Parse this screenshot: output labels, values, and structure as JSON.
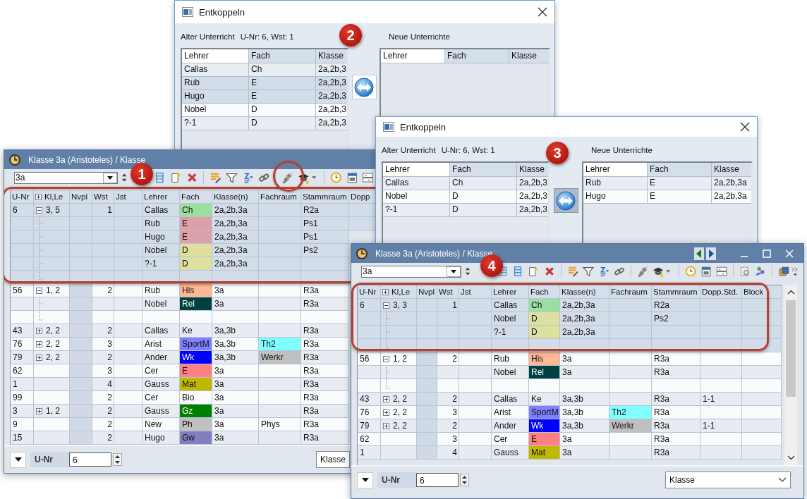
{
  "dialogs": [
    {
      "title": "Entkoppeln",
      "old_label": "Alter Unterricht",
      "old_info": "U-Nr: 6, Wst: 1",
      "new_label": "Neue Unterrichte",
      "badge": "2",
      "swap_pressed": false,
      "old_table": {
        "columns": [
          "Lehrer",
          "Fach",
          "Klasse"
        ],
        "rows": [
          {
            "cells": [
              "Callas",
              "Ch",
              "2a,2b,3"
            ],
            "selected": false
          },
          {
            "cells": [
              "Rub",
              "E",
              "2a,2b,3"
            ],
            "selected": true
          },
          {
            "cells": [
              "Hugo",
              "E",
              "2a,2b,3"
            ],
            "selected": true
          },
          {
            "cells": [
              "Nobel",
              "D",
              "2a,2b,3"
            ],
            "selected": false
          },
          {
            "cells": [
              "?-1",
              "D",
              "2a,2b,3"
            ],
            "selected": false
          }
        ]
      },
      "new_table": {
        "columns": [
          "Lehrer",
          "Fach",
          "Klasse"
        ]
      }
    },
    {
      "title": "Entkoppeln",
      "old_label": "Alter Unterricht",
      "old_info": "U-Nr: 6, Wst: 1",
      "new_label": "Neue Unterrichte",
      "badge": "3",
      "swap_pressed": true,
      "old_table": {
        "columns": [
          "Lehrer",
          "Fach",
          "Klasse"
        ],
        "rows": [
          {
            "cells": [
              "Callas",
              "Ch",
              "2a,2b,3"
            ],
            "selected": false
          },
          {
            "cells": [
              "Nobel",
              "D",
              "2a,2b,3"
            ],
            "selected": false
          },
          {
            "cells": [
              "?-1",
              "D",
              "2a,2b,3"
            ],
            "selected": false
          }
        ]
      },
      "new_table": {
        "columns": [
          "Lehrer",
          "Fach",
          "Klasse"
        ],
        "rows": [
          {
            "cells": [
              "Rub",
              "E",
              "2a,2b,3a"
            ],
            "selected": false
          },
          {
            "cells": [
              "Hugo",
              "E",
              "2a,2b,3a"
            ],
            "selected": false
          }
        ]
      }
    }
  ],
  "windows": [
    {
      "title": "Klasse 3a (Aristoteles) / Klasse",
      "class_value": "3a",
      "badge": "1",
      "columns": [
        "U-Nr",
        "Kl,Le",
        "Nvpl",
        "Wst",
        "Jst",
        "Lehrer",
        "Fach",
        "Klasse(n)",
        "Fachraum",
        "Stammraum",
        "Dopp"
      ],
      "rows": [
        {
          "u_nr": "6",
          "kl_le": "3, 5",
          "expanded": true,
          "wst": "1",
          "lehrer": "Callas",
          "fach": {
            "text": "Ch",
            "color": "#99e0a0"
          },
          "klassen": "2a,2b,3a",
          "stammraum": "R2a",
          "selected": true,
          "children": [
            {
              "lehrer": "Rub",
              "fach": {
                "text": "E",
                "color": "#dca0a8"
              },
              "klassen": "2a,2b,3a",
              "stammraum": "Ps1"
            },
            {
              "lehrer": "Hugo",
              "fach": {
                "text": "E",
                "color": "#dca0a8"
              },
              "klassen": "2a,2b,3a",
              "stammraum": "Ps1"
            },
            {
              "lehrer": "Nobel",
              "fach": {
                "text": "D",
                "color": "#dee0a0"
              },
              "klassen": "2a,2b,3a",
              "stammraum": "Ps2"
            },
            {
              "lehrer": "?-1",
              "fach": {
                "text": "D",
                "color": "#dee0a0"
              },
              "klassen": "2a,2b,3a"
            }
          ]
        },
        {
          "u_nr": "56",
          "kl_le": "1, 2",
          "expanded": true,
          "wst": "2",
          "lehrer": "Rub",
          "fach": {
            "text": "His",
            "color": "#ffb894"
          },
          "klassen": "3a",
          "stammraum": "R3a",
          "selected": false,
          "children": [
            {
              "lehrer": "Nobel",
              "fach": {
                "text": "Rel",
                "color": "#004040"
              },
              "klassen": "3a",
              "stammraum": "R3a"
            }
          ]
        },
        {
          "u_nr": "43",
          "kl_le": "2, 2",
          "expanded": false,
          "wst": "2",
          "lehrer": "Callas",
          "fach": {
            "text": "Ke"
          },
          "klassen": "3a,3b",
          "stammraum": "R3a",
          "selected": false
        },
        {
          "u_nr": "76",
          "kl_le": "2, 2",
          "expanded": false,
          "wst": "3",
          "lehrer": "Arist",
          "fach": {
            "text": "SportM",
            "color": "#8080ff"
          },
          "klassen": "3a,3b",
          "fachraum": {
            "text": "Th2",
            "color": "#80ffff"
          },
          "stammraum": "R3a",
          "selected": false
        },
        {
          "u_nr": "79",
          "kl_le": "2, 2",
          "expanded": false,
          "wst": "2",
          "lehrer": "Ander",
          "fach": {
            "text": "Wk",
            "color": "#0000ff"
          },
          "klassen": "3a,3b",
          "fachraum": {
            "text": "Werkr",
            "color": "#c0c0c0"
          },
          "stammraum": "R3a",
          "selected": false
        },
        {
          "u_nr": "62",
          "wst": "3",
          "lehrer": "Cer",
          "fach": {
            "text": "E",
            "color": "#ff8080"
          },
          "klassen": "3a",
          "stammraum": "R3a",
          "selected": false
        },
        {
          "u_nr": "1",
          "wst": "4",
          "lehrer": "Gauss",
          "fach": {
            "text": "Mat",
            "color": "#c0b800"
          },
          "klassen": "3a",
          "stammraum": "R3a",
          "selected": false
        },
        {
          "u_nr": "99",
          "wst": "2",
          "lehrer": "Cer",
          "fach": {
            "text": "Bio"
          },
          "klassen": "3a",
          "stammraum": "R3a",
          "selected": false
        },
        {
          "u_nr": "3",
          "kl_le": "1, 2",
          "expanded": false,
          "wst": "2",
          "lehrer": "Gauss",
          "fach": {
            "text": "Gz",
            "color": "#008000"
          },
          "klassen": "3a",
          "stammraum": "R3a",
          "selected": false
        },
        {
          "u_nr": "9",
          "wst": "2",
          "lehrer": "New",
          "fach": {
            "text": "Ph",
            "color": "#c0c0c0"
          },
          "klassen": "3a",
          "fachraum": {
            "text": "Phys"
          },
          "stammraum": "R3a",
          "selected": false
        },
        {
          "u_nr": "15",
          "wst": "2",
          "lehrer": "Hugo",
          "fach": {
            "text": "Gw",
            "color": "#8080c0"
          },
          "klassen": "3a",
          "stammraum": "R3a",
          "selected": false
        }
      ],
      "footer": {
        "label": "U-Nr",
        "value": "6",
        "view": "Klasse"
      }
    },
    {
      "title": "Klasse 3a (Aristoteles) / Klasse",
      "class_value": "3a",
      "badge": "4",
      "columns": [
        "U-Nr",
        "Kl,Le",
        "Nvpl",
        "Wst",
        "Jst",
        "Lehrer",
        "Fach",
        "Klasse(n)",
        "Fachraum",
        "Stammraum",
        "Dopp.Std.",
        "Block"
      ],
      "rows": [
        {
          "u_nr": "6",
          "kl_le": "3, 3",
          "expanded": true,
          "wst": "1",
          "lehrer": "Callas",
          "fach": {
            "text": "Ch",
            "color": "#99e0a0"
          },
          "klassen": "2a,2b,3a",
          "stammraum": "R2a",
          "selected": true,
          "children": [
            {
              "lehrer": "Nobel",
              "fach": {
                "text": "D",
                "color": "#dee0a0"
              },
              "klassen": "2a,2b,3a",
              "stammraum": "Ps2"
            },
            {
              "lehrer": "?-1",
              "fach": {
                "text": "D",
                "color": "#dee0a0"
              },
              "klassen": "2a,2b,3a"
            }
          ]
        },
        {
          "u_nr": "56",
          "kl_le": "1, 2",
          "expanded": true,
          "wst": "2",
          "lehrer": "Rub",
          "fach": {
            "text": "His",
            "color": "#ffb894"
          },
          "klassen": "3a",
          "stammraum": "R3a",
          "selected": false,
          "children": [
            {
              "lehrer": "Nobel",
              "fach": {
                "text": "Rel",
                "color": "#004040"
              },
              "klassen": "3a",
              "stammraum": "R3a"
            }
          ]
        },
        {
          "u_nr": "43",
          "kl_le": "2, 2",
          "expanded": false,
          "wst": "2",
          "lehrer": "Callas",
          "fach": {
            "text": "Ke"
          },
          "klassen": "3a,3b",
          "stammraum": "R3a",
          "dopp": "1-1",
          "selected": false
        },
        {
          "u_nr": "76",
          "kl_le": "2, 2",
          "expanded": false,
          "wst": "3",
          "lehrer": "Arist",
          "fach": {
            "text": "SportM",
            "color": "#8080ff"
          },
          "klassen": "3a,3b",
          "fachraum": {
            "text": "Th2",
            "color": "#80ffff"
          },
          "stammraum": "R3a",
          "selected": false
        },
        {
          "u_nr": "79",
          "kl_le": "2, 2",
          "expanded": false,
          "wst": "2",
          "lehrer": "Ander",
          "fach": {
            "text": "Wk",
            "color": "#0000ff"
          },
          "klassen": "3a,3b",
          "fachraum": {
            "text": "Werkr",
            "color": "#c0c0c0"
          },
          "stammraum": "R3a",
          "dopp": "1-1",
          "selected": false
        },
        {
          "u_nr": "62",
          "wst": "3",
          "lehrer": "Cer",
          "fach": {
            "text": "E",
            "color": "#ff8080"
          },
          "klassen": "3a",
          "stammraum": "R3a",
          "selected": false
        },
        {
          "u_nr": "1",
          "wst": "4",
          "lehrer": "Gauss",
          "fach": {
            "text": "Mat",
            "color": "#c0b800"
          },
          "klassen": "3a",
          "stammraum": "R3a",
          "selected": false
        }
      ],
      "footer": {
        "label": "U-Nr",
        "value": "6",
        "view": "Klasse"
      }
    }
  ]
}
